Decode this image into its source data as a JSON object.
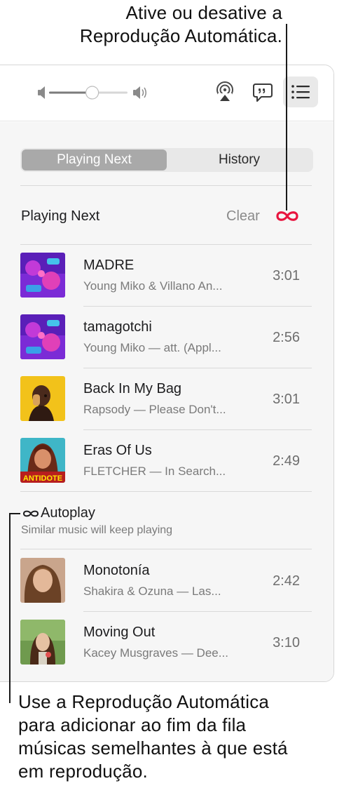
{
  "callouts": {
    "top": [
      "Ative ou desative a",
      "Reprodução Automática."
    ],
    "bottom": [
      "Use a Reprodução Automática",
      "para adicionar ao fim da fila",
      "músicas semelhantes à que está",
      "em reprodução."
    ]
  },
  "toolbar": {
    "volume_level": 0.55,
    "airplay_icon": "airplay-icon",
    "lyrics_icon": "lyrics-icon",
    "queue_icon": "queue-list-icon"
  },
  "segmented": {
    "tabs": [
      {
        "label": "Playing Next",
        "active": true
      },
      {
        "label": "History",
        "active": false
      }
    ]
  },
  "playing_next": {
    "title": "Playing Next",
    "clear_label": "Clear",
    "autoplay_icon": "infinity-icon",
    "accent_color": "#e8153f",
    "tracks": [
      {
        "title": "MADRE",
        "subtitle": "Young Miko & Villano An...",
        "duration": "3:01"
      },
      {
        "title": "tamagotchi",
        "subtitle": "Young Miko — att. (Appl...",
        "duration": "2:56"
      },
      {
        "title": "Back In My Bag",
        "subtitle": "Rapsody — Please Don't...",
        "duration": "3:01"
      },
      {
        "title": "Eras Of Us",
        "subtitle": "FLETCHER — In Search...",
        "duration": "2:49"
      }
    ]
  },
  "autoplay": {
    "title": "Autoplay",
    "subtitle": "Similar music will keep playing",
    "tracks": [
      {
        "title": "Monotonía",
        "subtitle": "Shakira & Ozuna — Las...",
        "duration": "2:42"
      },
      {
        "title": "Moving Out",
        "subtitle": "Kacey Musgraves — Dee...",
        "duration": "3:10"
      }
    ]
  },
  "album_art": {
    "eras_of_us_label": "ANTIDOTE"
  }
}
